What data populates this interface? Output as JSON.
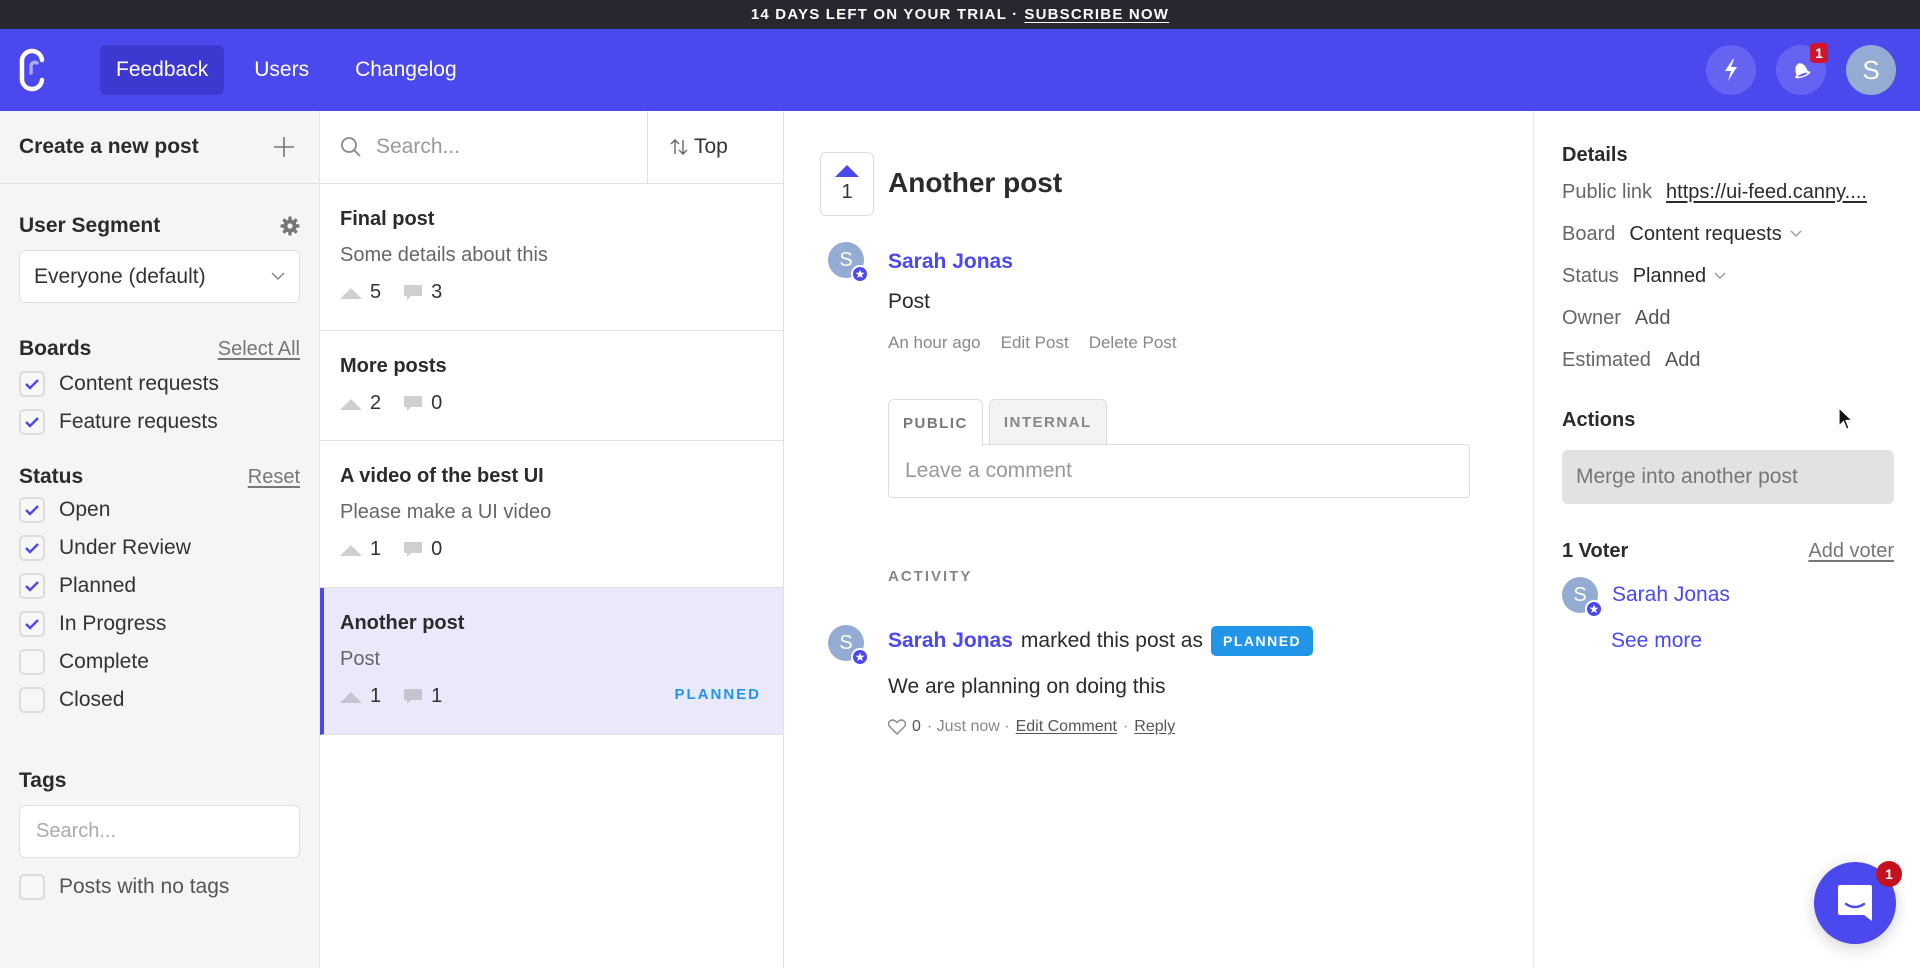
{
  "trial_banner": {
    "text": "14 DAYS LEFT ON YOUR TRIAL ·",
    "link": "SUBSCRIBE NOW"
  },
  "topnav": {
    "items": [
      {
        "label": "Feedback",
        "active": true
      },
      {
        "label": "Users",
        "active": false
      },
      {
        "label": "Changelog",
        "active": false
      }
    ],
    "notification_count": "1",
    "avatar_initial": "S",
    "brand_color": "#4b48ee"
  },
  "sidebar": {
    "create_post_label": "Create a new post",
    "user_segment": {
      "title": "User Segment",
      "selected": "Everyone (default)"
    },
    "boards": {
      "title": "Boards",
      "action": "Select All",
      "items": [
        {
          "label": "Content requests",
          "checked": true
        },
        {
          "label": "Feature requests",
          "checked": true
        }
      ]
    },
    "status": {
      "title": "Status",
      "action": "Reset",
      "items": [
        {
          "label": "Open",
          "checked": true
        },
        {
          "label": "Under Review",
          "checked": true
        },
        {
          "label": "Planned",
          "checked": true
        },
        {
          "label": "In Progress",
          "checked": true
        },
        {
          "label": "Complete",
          "checked": false
        },
        {
          "label": "Closed",
          "checked": false
        }
      ]
    },
    "tags": {
      "title": "Tags",
      "search_placeholder": "Search...",
      "no_tags_label": "Posts with no tags",
      "no_tags_checked": false
    }
  },
  "postlist": {
    "search_placeholder": "Search...",
    "sort_label": "Top",
    "posts": [
      {
        "title": "Final post",
        "description": "Some details about this",
        "votes": "5",
        "comments": "3",
        "status": ""
      },
      {
        "title": "More posts",
        "description": "",
        "votes": "2",
        "comments": "0",
        "status": ""
      },
      {
        "title": "A video of the best UI",
        "description": "Please make a UI video",
        "votes": "1",
        "comments": "0",
        "status": ""
      },
      {
        "title": "Another post",
        "description": "Post",
        "votes": "1",
        "comments": "1",
        "status": "PLANNED",
        "selected": true
      }
    ]
  },
  "detail": {
    "vote_count": "1",
    "title": "Another post",
    "author": "Sarah Jonas",
    "author_initial": "S",
    "body": "Post",
    "time": "An hour ago",
    "edit_label": "Edit Post",
    "delete_label": "Delete Post",
    "tabs": [
      {
        "label": "PUBLIC",
        "active": true
      },
      {
        "label": "INTERNAL",
        "active": false
      }
    ],
    "comment_placeholder": "Leave a comment",
    "activity_label": "ACTIVITY",
    "activity": {
      "author": "Sarah Jonas",
      "action": "marked this post as",
      "status_pill": "PLANNED",
      "text": "We are planning on doing this",
      "likes": "0",
      "time": "· Just now ·",
      "edit_label": "Edit Comment",
      "separator": "·",
      "reply_label": "Reply"
    }
  },
  "details_panel": {
    "title": "Details",
    "public_link_label": "Public link",
    "public_link_value": "https://ui-feed.canny....",
    "board_label": "Board",
    "board_value": "Content requests",
    "status_label": "Status",
    "status_value": "Planned",
    "owner_label": "Owner",
    "owner_value": "Add",
    "estimated_label": "Estimated",
    "estimated_value": "Add",
    "actions_title": "Actions",
    "merge_label": "Merge into another post",
    "voters_title": "1 Voter",
    "add_voter_label": "Add voter",
    "voter_name": "Sarah Jonas",
    "voter_initial": "S",
    "see_more_label": "See more"
  },
  "chat": {
    "badge_count": "1"
  }
}
